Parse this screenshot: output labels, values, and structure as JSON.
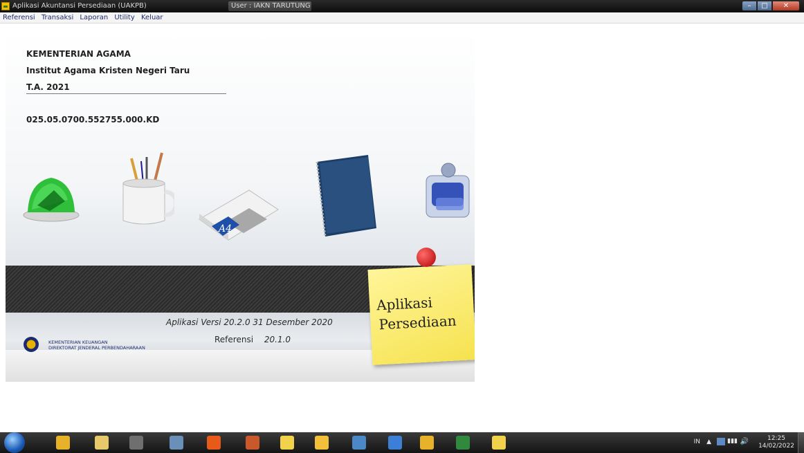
{
  "window": {
    "title": "Aplikasi Akuntansi Persediaan (UAKPB)",
    "user": "User : IAKN TARUTUNG"
  },
  "menu": [
    "Referensi",
    "Transaksi",
    "Laporan",
    "Utility",
    "Keluar"
  ],
  "splash": {
    "line1": "KEMENTERIAN AGAMA",
    "line2": "Institut Agama Kristen Negeri Taru",
    "ta": "T.A. 2021",
    "code": "025.05.0700.552755.000.KD",
    "version": "Aplikasi Versi 20.2.0 31 Desember 2020",
    "referensi_label": "Referensi",
    "referensi_value": "20.1.0",
    "kemenkeu_line1": "KEMENTERIAN KEUANGAN",
    "kemenkeu_line2": "DIREKTORAT JENDERAL PERBENDAHARAAN",
    "sticky_line1": "Aplikasi",
    "sticky_line2": "Persediaan",
    "paper_label": "A4"
  },
  "taskbar": {
    "lang": "IN",
    "time": "12:25",
    "date": "14/02/2022",
    "apps": [
      {
        "name": "chrome",
        "color": "#e8b12a"
      },
      {
        "name": "explorer",
        "color": "#e7c96b"
      },
      {
        "name": "media",
        "color": "#6f6f6f"
      },
      {
        "name": "calculator",
        "color": "#6a8fb8"
      },
      {
        "name": "firefox",
        "color": "#e65a1a"
      },
      {
        "name": "fox-app",
        "color": "#c9592a"
      },
      {
        "name": "persediaan-1",
        "color": "#f2d24a"
      },
      {
        "name": "persediaan-2",
        "color": "#f2c03a"
      },
      {
        "name": "photos",
        "color": "#4a88c7"
      },
      {
        "name": "app-circle",
        "color": "#3b7fd6"
      },
      {
        "name": "chrome-2",
        "color": "#e8b12a"
      },
      {
        "name": "excel",
        "color": "#2f8a3e"
      },
      {
        "name": "persediaan-3",
        "color": "#f2d24a"
      }
    ]
  }
}
